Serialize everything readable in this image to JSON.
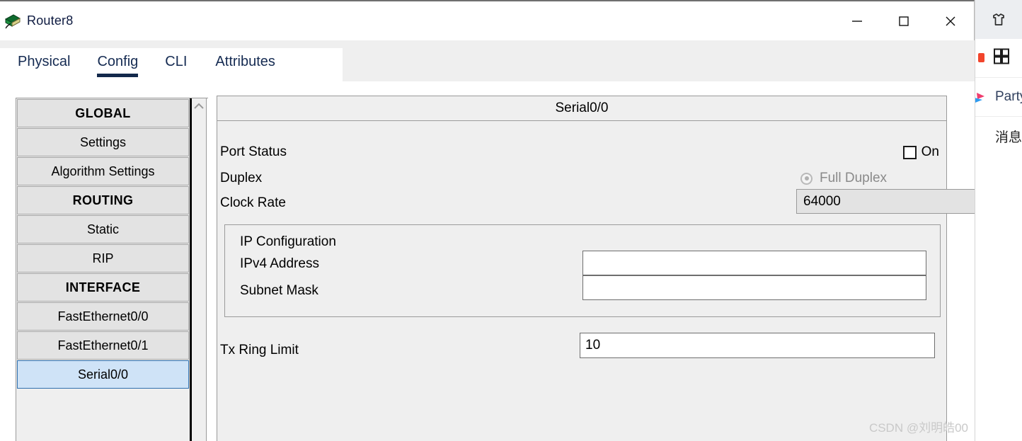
{
  "window": {
    "title": "Router8",
    "icon": "router-icon",
    "controls": {
      "minimize": "minimize-icon",
      "maximize": "maximize-icon",
      "close": "close-icon"
    }
  },
  "tabs": [
    {
      "label": "Physical",
      "active": false
    },
    {
      "label": "Config",
      "active": true
    },
    {
      "label": "CLI",
      "active": false
    },
    {
      "label": "Attributes",
      "active": false
    }
  ],
  "sidebar": {
    "items": [
      {
        "label": "GLOBAL",
        "type": "header",
        "selected": false
      },
      {
        "label": "Settings",
        "type": "item",
        "selected": false
      },
      {
        "label": "Algorithm Settings",
        "type": "item",
        "selected": false
      },
      {
        "label": "ROUTING",
        "type": "header",
        "selected": false
      },
      {
        "label": "Static",
        "type": "item",
        "selected": false
      },
      {
        "label": "RIP",
        "type": "item",
        "selected": false
      },
      {
        "label": "INTERFACE",
        "type": "header",
        "selected": false
      },
      {
        "label": "FastEthernet0/0",
        "type": "item",
        "selected": false
      },
      {
        "label": "FastEthernet0/1",
        "type": "item",
        "selected": false
      },
      {
        "label": "Serial0/0",
        "type": "item",
        "selected": true
      }
    ],
    "scroll_up_icon": "chevron-up-icon"
  },
  "panel": {
    "title": "Serial0/0",
    "port_status": {
      "label": "Port Status",
      "checkbox_label": "On",
      "checked": false
    },
    "duplex": {
      "label": "Duplex",
      "option_label": "Full Duplex",
      "selected": true,
      "disabled": true
    },
    "clock_rate": {
      "label": "Clock Rate",
      "value": "64000",
      "caret_icon": "chevron-down-icon"
    },
    "ip_configuration": {
      "title": "IP Configuration",
      "ipv4_label": "IPv4 Address",
      "ipv4_value": "",
      "ipv4_placeholder": "",
      "subnet_label": "Subnet Mask",
      "subnet_value": "",
      "subnet_placeholder": ""
    },
    "tx_ring_limit": {
      "label": "Tx Ring Limit",
      "value": "10"
    }
  },
  "side_strip": {
    "top_icon": "tshirt-icon",
    "items": [
      {
        "label": "",
        "icon": "grid-apps-icon"
      },
      {
        "label": "Party",
        "icon": "party-icon"
      },
      {
        "label": "消息",
        "icon": "message-icon"
      }
    ]
  },
  "watermark": "CSDN @刘明皓00",
  "colors": {
    "tab_active_underline": "#13294b",
    "tab_text": "#152b52",
    "selection_bg": "#cfe3f7",
    "selection_border": "#2f6fad",
    "panel_bg": "#efefef",
    "nav_item_bg": "#e3e3e3"
  }
}
